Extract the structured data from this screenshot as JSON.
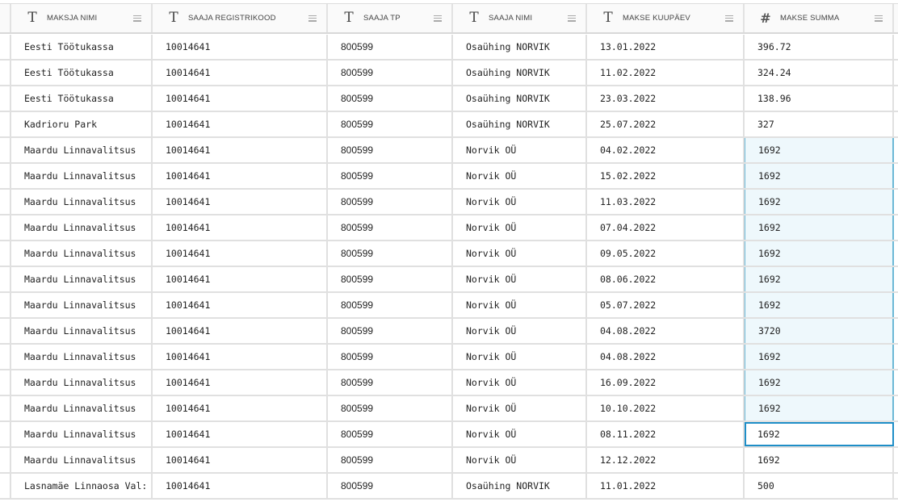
{
  "columns": [
    {
      "label": "MAKSJA NIMI",
      "type_icon": "text-type-icon",
      "type_glyph": "T"
    },
    {
      "label": "SAAJA REGISTRIKOOD",
      "type_icon": "text-type-icon",
      "type_glyph": "T"
    },
    {
      "label": "SAAJA TP",
      "type_icon": "text-type-icon",
      "type_glyph": "T"
    },
    {
      "label": "SAAJA NIMI",
      "type_icon": "text-type-icon",
      "type_glyph": "T"
    },
    {
      "label": "MAKSE KUUPÄEV",
      "type_icon": "text-type-icon",
      "type_glyph": "T"
    },
    {
      "label": "MAKSE SUMMA",
      "type_icon": "number-type-icon",
      "type_glyph": "#"
    }
  ],
  "rows": [
    {
      "payer": "Eesti Töötukassa",
      "reg": "10014641",
      "tp": "800599",
      "recipient": "Osaühing NORVIK",
      "date": "13.01.2022",
      "amount": "396.72",
      "state": ""
    },
    {
      "payer": "Eesti Töötukassa",
      "reg": "10014641",
      "tp": "800599",
      "recipient": "Osaühing NORVIK",
      "date": "11.02.2022",
      "amount": "324.24",
      "state": ""
    },
    {
      "payer": "Eesti Töötukassa",
      "reg": "10014641",
      "tp": "800599",
      "recipient": "Osaühing NORVIK",
      "date": "23.03.2022",
      "amount": "138.96",
      "state": ""
    },
    {
      "payer": "Kadrioru Park",
      "reg": "10014641",
      "tp": "800599",
      "recipient": "Osaühing NORVIK",
      "date": "25.07.2022",
      "amount": "327",
      "state": ""
    },
    {
      "payer": "Maardu Linnavalitsus",
      "reg": "10014641",
      "tp": "800599",
      "recipient": "Norvik OÜ",
      "date": "04.02.2022",
      "amount": "1692",
      "state": "selected"
    },
    {
      "payer": "Maardu Linnavalitsus",
      "reg": "10014641",
      "tp": "800599",
      "recipient": "Norvik OÜ",
      "date": "15.02.2022",
      "amount": "1692",
      "state": "selected"
    },
    {
      "payer": "Maardu Linnavalitsus",
      "reg": "10014641",
      "tp": "800599",
      "recipient": "Norvik OÜ",
      "date": "11.03.2022",
      "amount": "1692",
      "state": "selected"
    },
    {
      "payer": "Maardu Linnavalitsus",
      "reg": "10014641",
      "tp": "800599",
      "recipient": "Norvik OÜ",
      "date": "07.04.2022",
      "amount": "1692",
      "state": "selected"
    },
    {
      "payer": "Maardu Linnavalitsus",
      "reg": "10014641",
      "tp": "800599",
      "recipient": "Norvik OÜ",
      "date": "09.05.2022",
      "amount": "1692",
      "state": "selected"
    },
    {
      "payer": "Maardu Linnavalitsus",
      "reg": "10014641",
      "tp": "800599",
      "recipient": "Norvik OÜ",
      "date": "08.06.2022",
      "amount": "1692",
      "state": "selected"
    },
    {
      "payer": "Maardu Linnavalitsus",
      "reg": "10014641",
      "tp": "800599",
      "recipient": "Norvik OÜ",
      "date": "05.07.2022",
      "amount": "1692",
      "state": "selected"
    },
    {
      "payer": "Maardu Linnavalitsus",
      "reg": "10014641",
      "tp": "800599",
      "recipient": "Norvik OÜ",
      "date": "04.08.2022",
      "amount": "3720",
      "state": "selected"
    },
    {
      "payer": "Maardu Linnavalitsus",
      "reg": "10014641",
      "tp": "800599",
      "recipient": "Norvik OÜ",
      "date": "04.08.2022",
      "amount": "1692",
      "state": "selected"
    },
    {
      "payer": "Maardu Linnavalitsus",
      "reg": "10014641",
      "tp": "800599",
      "recipient": "Norvik OÜ",
      "date": "16.09.2022",
      "amount": "1692",
      "state": "selected"
    },
    {
      "payer": "Maardu Linnavalitsus",
      "reg": "10014641",
      "tp": "800599",
      "recipient": "Norvik OÜ",
      "date": "10.10.2022",
      "amount": "1692",
      "state": "selected"
    },
    {
      "payer": "Maardu Linnavalitsus",
      "reg": "10014641",
      "tp": "800599",
      "recipient": "Norvik OÜ",
      "date": "08.11.2022",
      "amount": "1692",
      "state": "active"
    },
    {
      "payer": "Maardu Linnavalitsus",
      "reg": "10014641",
      "tp": "800599",
      "recipient": "Norvik OÜ",
      "date": "12.12.2022",
      "amount": "1692",
      "state": ""
    },
    {
      "payer": "Lasnamäe Linnaosa Val:",
      "reg": "10014641",
      "tp": "800599",
      "recipient": "Osaühing NORVIK",
      "date": "11.01.2022",
      "amount": "500",
      "state": ""
    }
  ],
  "colors": {
    "selection_fill": "#eef8fc",
    "selection_border": "#6bb8d6",
    "active_border": "#1e8ec7"
  }
}
